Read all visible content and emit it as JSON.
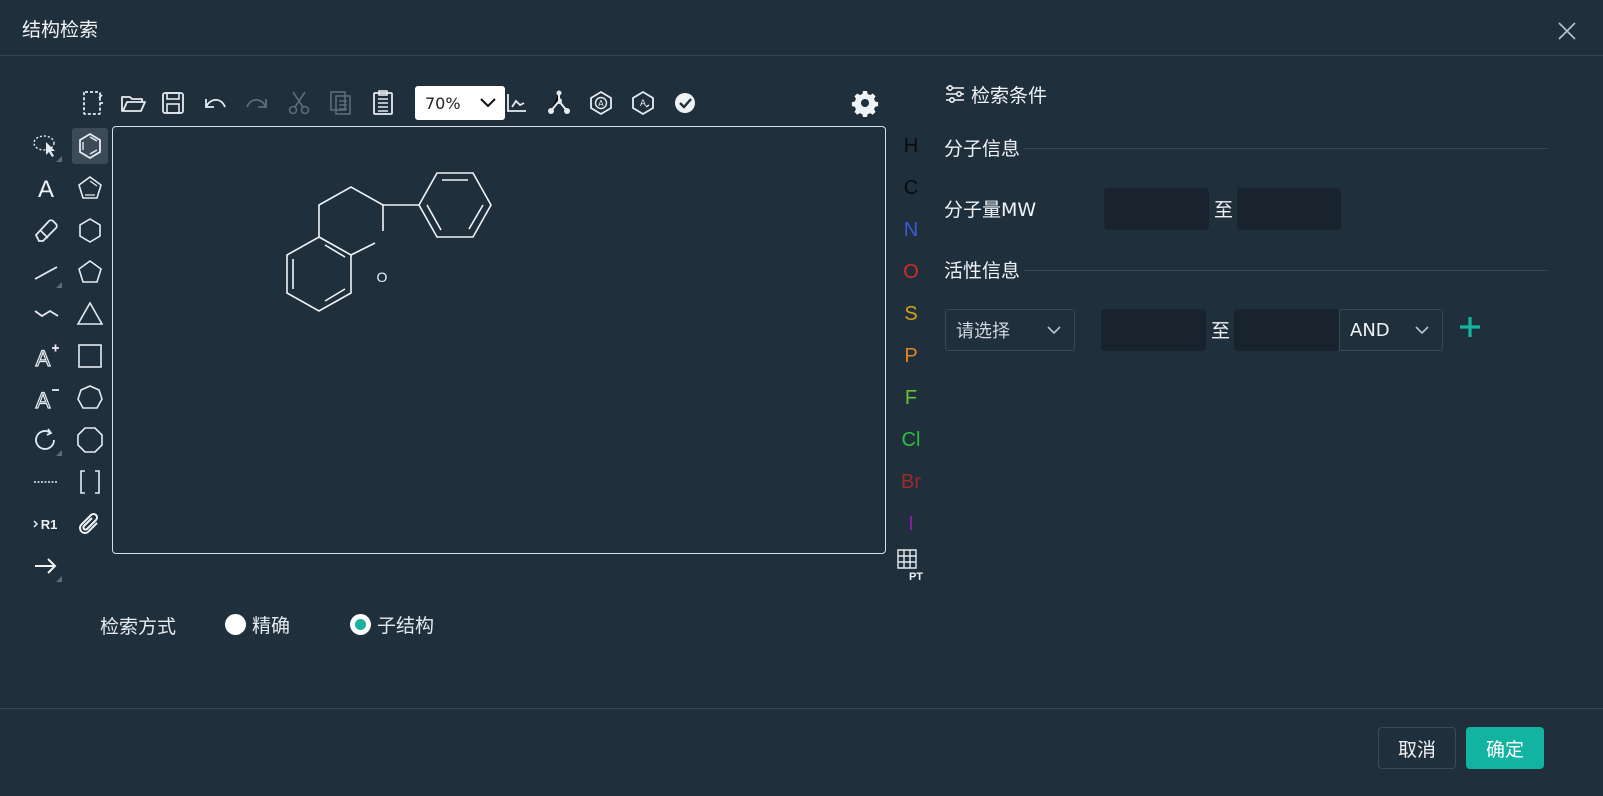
{
  "dialog": {
    "title": "结构检索"
  },
  "toolbar": {
    "zoom": "70%"
  },
  "atoms": [
    {
      "label": "H",
      "color": "#0b0b0b"
    },
    {
      "label": "C",
      "color": "#0b0b0b"
    },
    {
      "label": "N",
      "color": "#3b5bd6"
    },
    {
      "label": "O",
      "color": "#d42a2a"
    },
    {
      "label": "S",
      "color": "#d4a019"
    },
    {
      "label": "P",
      "color": "#e5831e"
    },
    {
      "label": "F",
      "color": "#6bbf3a"
    },
    {
      "label": "Cl",
      "color": "#27c13a"
    },
    {
      "label": "Br",
      "color": "#9e2a2a"
    },
    {
      "label": "I",
      "color": "#8a1ea6"
    }
  ],
  "periodic_table_label": "PT",
  "rgroup_label": "R1",
  "molecule": {
    "oxygen_label": "O"
  },
  "search_mode": {
    "label": "检索方式",
    "options": [
      {
        "label": "精确",
        "checked": false
      },
      {
        "label": "子结构",
        "checked": true
      }
    ]
  },
  "panel": {
    "title": "检索条件",
    "molecule_section": "分子信息",
    "mw_label": "分子量MW",
    "to": "至",
    "activity_section": "活性信息",
    "activity_select_placeholder": "请选择",
    "logic_select": "AND"
  },
  "footer": {
    "cancel": "取消",
    "ok": "确定"
  },
  "colors": {
    "accent": "#13b3a2",
    "background": "#202f3c"
  }
}
